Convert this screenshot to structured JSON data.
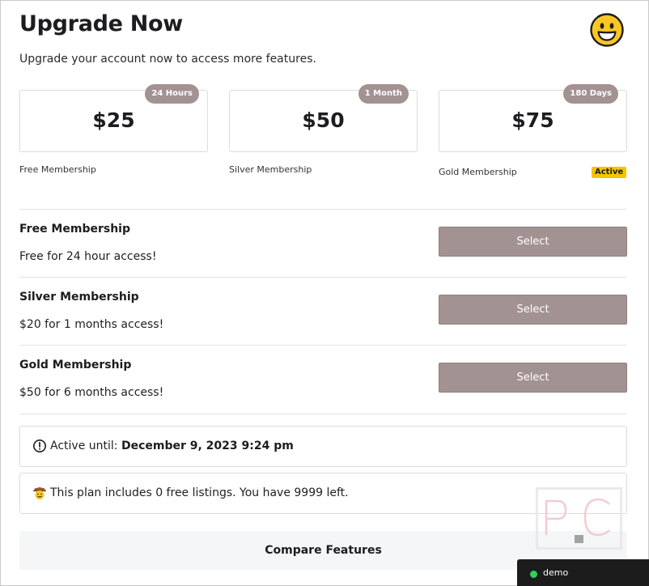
{
  "header": {
    "title": "Upgrade Now",
    "subtitle": "Upgrade your account now to access more features.",
    "emoji_icon": "grinning-face-icon"
  },
  "price_cards": [
    {
      "price": "$25",
      "duration": "24 Hours",
      "label": "Free Membership"
    },
    {
      "price": "$50",
      "duration": "1 Month",
      "label": "Silver Membership"
    },
    {
      "price": "$75",
      "duration": "180 Days",
      "label": "Gold Membership",
      "status": "Active"
    }
  ],
  "plans": [
    {
      "name": "Free Membership",
      "description": "Free for 24 hour access!",
      "button": "Select"
    },
    {
      "name": "Silver Membership",
      "description": "$20 for 1 months access!",
      "button": "Select"
    },
    {
      "name": "Gold Membership",
      "description": "$50 for 6 months access!",
      "button": "Select"
    }
  ],
  "active_info": {
    "prefix": "Active until:",
    "date": "December 9, 2023 9:24 pm",
    "icon": "clock-alert-icon"
  },
  "listings_info": {
    "text": "This plan includes 0 free listings. You have 9999 left.",
    "icon": "cowboy-face-icon"
  },
  "compare_button": "Compare Features",
  "demo": {
    "label": "demo",
    "status_color": "#2ed15b"
  },
  "colors": {
    "badge": "#a39292",
    "select_button": "#a39292",
    "active_badge": "#f5c400",
    "demo_bg": "#1c1c1c"
  }
}
